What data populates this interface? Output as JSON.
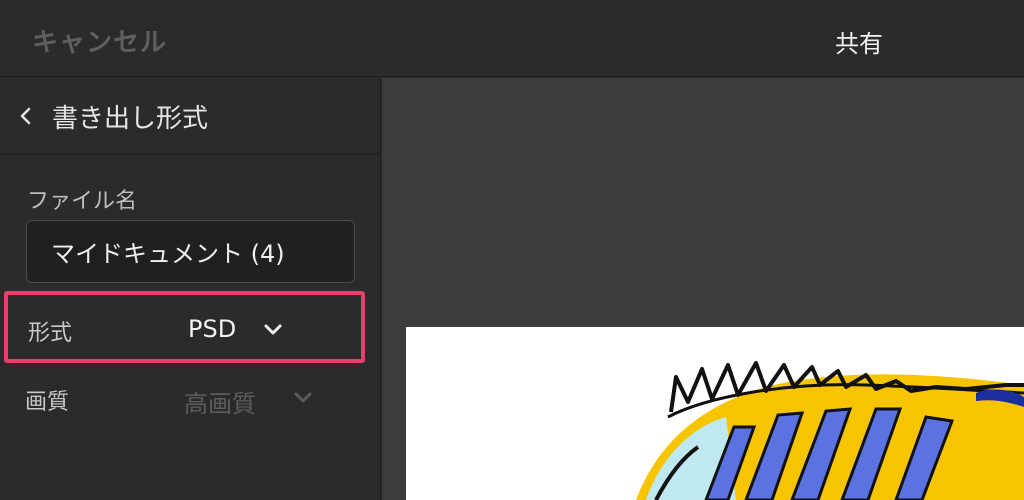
{
  "header": {
    "cancel_label": "キャンセル",
    "share_label": "共有"
  },
  "sidebar": {
    "back_label": "書き出し形式",
    "file_name": {
      "label": "ファイル名",
      "value": "マイドキュメント (4)"
    },
    "format": {
      "label": "形式",
      "value": "PSD"
    },
    "quality": {
      "label": "画質",
      "value": "高画質"
    }
  },
  "colors": {
    "highlight": "#ea3f6e",
    "fish_blue": "#5a73e0",
    "fish_yellow": "#f7c400"
  }
}
